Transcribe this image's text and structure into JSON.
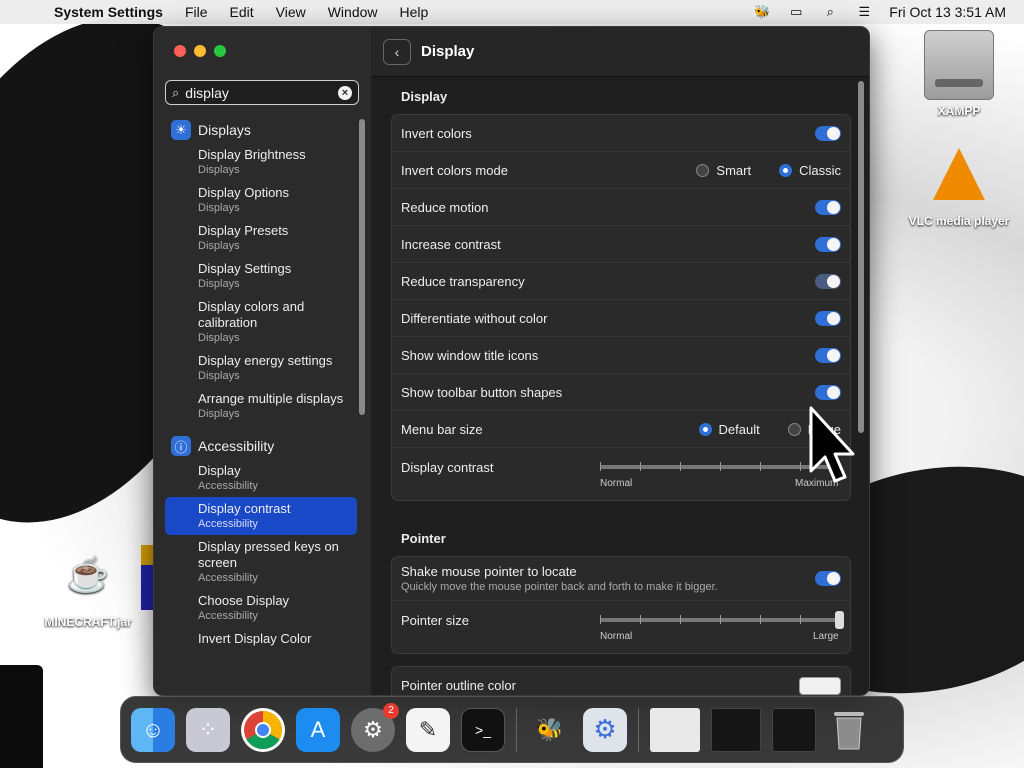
{
  "menubar": {
    "app_name": "System Settings",
    "menus": [
      "File",
      "Edit",
      "View",
      "Window",
      "Help"
    ],
    "clock": "Fri Oct 13  3:51 AM"
  },
  "desktop": {
    "icons": [
      "XAMPP",
      "VLC media player",
      "MINECRAFT.jar"
    ]
  },
  "search": {
    "value": "display"
  },
  "sidebar": {
    "group_displays": "Displays",
    "displays_items": [
      {
        "title": "Display Brightness",
        "sub": "Displays"
      },
      {
        "title": "Display Options",
        "sub": "Displays"
      },
      {
        "title": "Display Presets",
        "sub": "Displays"
      },
      {
        "title": "Display Settings",
        "sub": "Displays"
      },
      {
        "title": "Display colors and calibration",
        "sub": "Displays"
      },
      {
        "title": "Display energy settings",
        "sub": "Displays"
      },
      {
        "title": "Arrange multiple displays",
        "sub": "Displays"
      }
    ],
    "group_accessibility": "Accessibility",
    "accessibility_items": [
      {
        "title": "Display",
        "sub": "Accessibility"
      },
      {
        "title": "Display contrast",
        "sub": "Accessibility"
      },
      {
        "title": "Display pressed keys on screen",
        "sub": "Accessibility"
      },
      {
        "title": "Choose Display",
        "sub": "Accessibility"
      },
      {
        "title": "Invert Display Color",
        "sub": ""
      }
    ]
  },
  "main": {
    "title": "Display",
    "display_section": "Display",
    "rows": {
      "invert_colors": "Invert colors",
      "invert_colors_mode": "Invert colors mode",
      "mode_smart": "Smart",
      "mode_classic": "Classic",
      "reduce_motion": "Reduce motion",
      "increase_contrast": "Increase contrast",
      "reduce_transparency": "Reduce transparency",
      "differentiate": "Differentiate without color",
      "window_title_icons": "Show window title icons",
      "toolbar_shapes": "Show toolbar button shapes",
      "menu_bar_size": "Menu bar size",
      "size_default": "Default",
      "size_large": "Large",
      "display_contrast": "Display contrast",
      "contrast_min": "Normal",
      "contrast_max": "Maximum"
    },
    "pointer_section": "Pointer",
    "pointer": {
      "shake": "Shake mouse pointer to locate",
      "shake_sub": "Quickly move the mouse pointer back and forth to make it bigger.",
      "pointer_size": "Pointer size",
      "size_min": "Normal",
      "size_max": "Large",
      "outline_color": "Pointer outline color"
    }
  },
  "dock": {
    "apps": [
      "finder-icon",
      "launchpad-icon",
      "chrome-icon",
      "app-store-icon",
      "system-settings-icon",
      "textedit-icon",
      "terminal-icon",
      "bee-icon",
      "gear-app-icon",
      "window-thumb-1",
      "window-thumb-2",
      "window-thumb-3",
      "trash-icon"
    ],
    "settings_badge": "2"
  }
}
